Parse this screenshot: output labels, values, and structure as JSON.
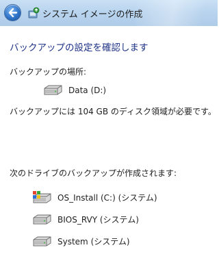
{
  "window": {
    "title": "システム イメージの作成"
  },
  "main": {
    "heading": "バックアップの設定を確認します",
    "location_label": "バックアップの場所:",
    "location_drive": "Data (D:)",
    "space_note": "バックアップには 104 GB のディスク領域が必要です。",
    "drives_label": "次のドライブのバックアップが作成されます:",
    "drives": [
      {
        "label": "OS_Install (C:) (システム)",
        "icon": "windows-drive-icon"
      },
      {
        "label": "BIOS_RVY (システム)",
        "icon": "hard-drive-icon"
      },
      {
        "label": "System (システム)",
        "icon": "hard-drive-icon"
      }
    ]
  },
  "colors": {
    "heading": "#1e3287",
    "titlebar": "#b9d4ee",
    "back_button": "#2f74c8"
  }
}
